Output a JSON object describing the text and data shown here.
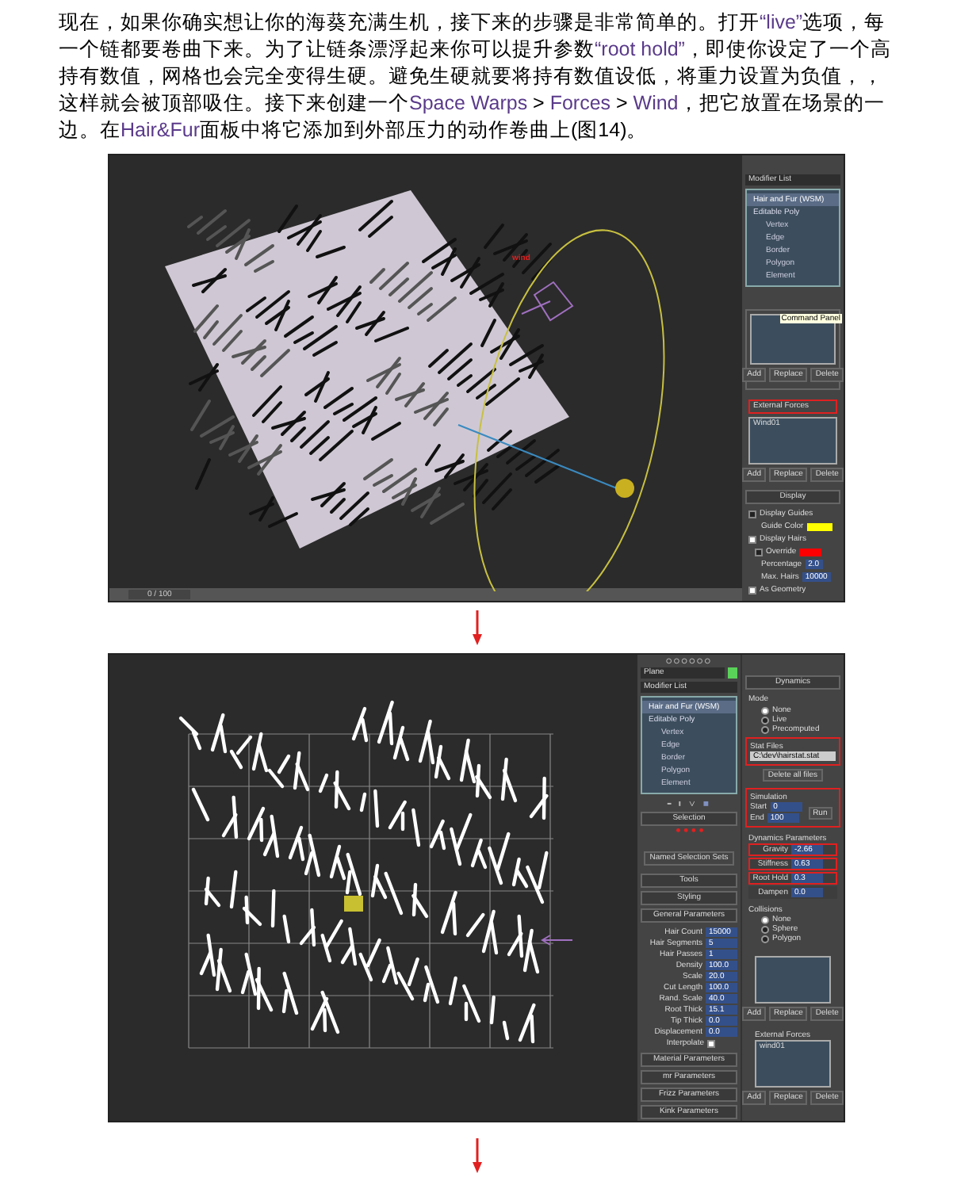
{
  "article": {
    "paragraph": [
      {
        "kind": "text",
        "text": "现在，如果你确实想让你的海葵充满生机，接下来的步骤是非常简单的。打开"
      },
      {
        "kind": "link",
        "text": "“live”"
      },
      {
        "kind": "text",
        "text": "选项，每一个链都要卷曲下来。为了让链条漂浮起来你可以提升参数"
      },
      {
        "kind": "link",
        "text": "“root hold”"
      },
      {
        "kind": "text",
        "text": "，即使你设定了一个高持有数值，网格也会完全变得生硬。避免生硬就要将持有数值设低，将重力设置为负值，，这样就会被顶部吸住。接下来创建一个"
      },
      {
        "kind": "link",
        "text": "Space Warps"
      },
      {
        "kind": "text",
        "text": " > "
      },
      {
        "kind": "link",
        "text": "Forces"
      },
      {
        "kind": "text",
        "text": " > "
      },
      {
        "kind": "link",
        "text": "Wind"
      },
      {
        "kind": "text",
        "text": "，把它放置在场景的一边。在"
      },
      {
        "kind": "link",
        "text": "Hair&Fur"
      },
      {
        "kind": "text",
        "text": "面板中将它添加到外部压力的动作卷曲上(图14)。"
      }
    ]
  },
  "figure_top": {
    "viewport": {
      "label": "wind",
      "timeline": "0 / 100"
    },
    "panel": {
      "modifier_list": "Modifier List",
      "stack": [
        {
          "label": "Hair and Fur (WSM)",
          "selected": true
        },
        {
          "label": "Editable Poly",
          "selected": false,
          "children": [
            {
              "label": "Vertex",
              "selected": false
            },
            {
              "label": "Edge",
              "selected": false
            },
            {
              "label": "Border",
              "selected": false
            },
            {
              "label": "Polygon",
              "selected": false
            },
            {
              "label": "Element",
              "selected": false
            }
          ]
        }
      ],
      "tooltip": "Command Panel",
      "list_buttons": [
        "Add",
        "Replace",
        "Delete"
      ],
      "external_forces": {
        "label": "External Forces",
        "highlighted": true,
        "items": [
          "Wind01"
        ],
        "buttons": [
          "Add",
          "Replace",
          "Delete"
        ]
      },
      "display": {
        "title": "Display",
        "options": [
          {
            "kind": "check",
            "label": "Display Guides",
            "checked": false
          },
          {
            "kind": "color",
            "label": "Guide Color",
            "color": "#ffff00"
          },
          {
            "kind": "check",
            "label": "Display Hairs",
            "checked": true
          },
          {
            "kind": "checkcolor",
            "label": "Override",
            "checked": false,
            "color": "#ff0000"
          },
          {
            "kind": "value",
            "label": "Percentage",
            "value": "2.0"
          },
          {
            "kind": "value",
            "label": "Max. Hairs",
            "value": "10000"
          },
          {
            "kind": "check",
            "label": "As Geometry",
            "checked": true
          }
        ]
      }
    }
  },
  "figure_bottom": {
    "panel": {
      "object_name": "Plane",
      "modifier_list": "Modifier List",
      "stack": [
        {
          "label": "Hair and Fur (WSM)",
          "selected": true
        },
        {
          "label": "Editable Poly",
          "selected": false,
          "children": [
            {
              "label": "Vertex",
              "selected": false
            },
            {
              "label": "Edge",
              "selected": false
            },
            {
              "label": "Border",
              "selected": false
            },
            {
              "label": "Polygon",
              "selected": false
            },
            {
              "label": "Element",
              "selected": false
            }
          ]
        }
      ],
      "selection": {
        "title": "Selection",
        "named_sets": "Named Selection Sets"
      },
      "rollouts_top": [
        "Tools",
        "Styling",
        "General Parameters"
      ],
      "general": [
        {
          "label": "Hair Count",
          "value": "15000"
        },
        {
          "label": "Hair Segments",
          "value": "5"
        },
        {
          "label": "Hair Passes",
          "value": "1"
        },
        {
          "label": "Density",
          "value": "100.0"
        },
        {
          "label": "Scale",
          "value": "20.0"
        },
        {
          "label": "Cut Length",
          "value": "100.0"
        },
        {
          "label": "Rand. Scale",
          "value": "40.0"
        },
        {
          "label": "Root Thick",
          "value": "15.1"
        },
        {
          "label": "Tip Thick",
          "value": "0.0"
        },
        {
          "label": "Displacement",
          "value": "0.0"
        }
      ],
      "interpolate": {
        "label": "Interpolate",
        "checked": true
      },
      "rollouts_bottom": [
        "Material Parameters",
        "mr Parameters",
        "Frizz Parameters",
        "Kink Parameters"
      ],
      "dynamics": {
        "title": "Dynamics",
        "mode_label": "Mode",
        "modes": [
          {
            "label": "None",
            "selected": true
          },
          {
            "label": "Live",
            "selected": false
          },
          {
            "label": "Precomputed",
            "selected": false
          }
        ],
        "stat_files": {
          "label": "Stat Files",
          "value": "C:\\dev\\hairstat.stat",
          "highlighted": true
        },
        "delete_files": "Delete all files",
        "simulation": {
          "label": "Simulation",
          "highlighted": true,
          "start_label": "Start",
          "start": "0",
          "end_label": "End",
          "end": "100",
          "run": "Run"
        },
        "params_label": "Dynamics Parameters",
        "params": [
          {
            "label": "Gravity",
            "value": "-2.66",
            "highlighted": true
          },
          {
            "label": "Stiffness",
            "value": "0.63",
            "highlighted": true
          },
          {
            "label": "Root Hold",
            "value": "0.3",
            "highlighted": true
          },
          {
            "label": "Dampen",
            "value": "0.0",
            "highlighted": false
          }
        ],
        "collisions_label": "Collisions",
        "collisions": [
          {
            "label": "None",
            "selected": true
          },
          {
            "label": "Sphere",
            "selected": false
          },
          {
            "label": "Polygon",
            "selected": false
          }
        ],
        "list_buttons": [
          "Add",
          "Replace",
          "Delete"
        ],
        "external_forces": {
          "label": "External Forces",
          "items": [
            "wind01"
          ],
          "buttons": [
            "Add",
            "Replace",
            "Delete"
          ]
        }
      }
    }
  }
}
